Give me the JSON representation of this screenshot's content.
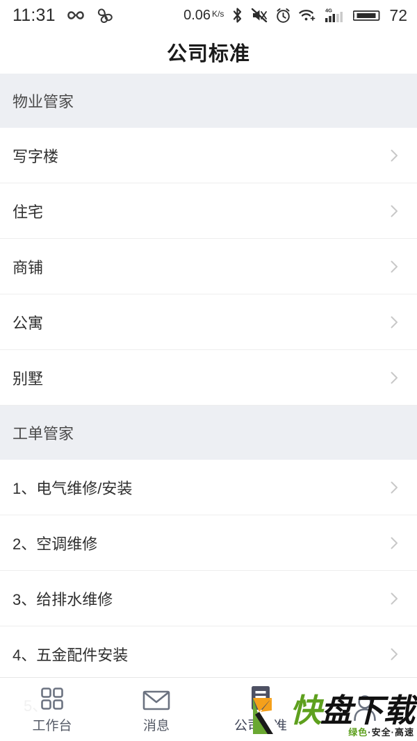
{
  "status_bar": {
    "time": "11:31",
    "left_icons": [
      "infinity-icon",
      "clover-icon"
    ],
    "network_speed": "0.06",
    "network_speed_unit_top": "K",
    "network_speed_unit_bottom": "s",
    "right_icons": [
      "bluetooth-icon",
      "mute-icon",
      "alarm-icon",
      "wifi-plus-icon",
      "signal-4g-icon"
    ],
    "signal_label": "4G",
    "battery_level": "72"
  },
  "header": {
    "title": "公司标准"
  },
  "sections": [
    {
      "title": "物业管家",
      "items": [
        {
          "label": "写字楼"
        },
        {
          "label": "住宅"
        },
        {
          "label": "商铺"
        },
        {
          "label": "公寓"
        },
        {
          "label": "别墅"
        }
      ]
    },
    {
      "title": "工单管家",
      "items": [
        {
          "label": "1、电气维修/安装"
        },
        {
          "label": "2、空调维修"
        },
        {
          "label": "3、给排水维修"
        },
        {
          "label": "4、五金配件安装"
        }
      ]
    }
  ],
  "ghost_text": "5、",
  "tabbar": {
    "tabs": [
      {
        "label": "工作台",
        "icon": "grid-icon",
        "active": false
      },
      {
        "label": "消息",
        "icon": "envelope-icon",
        "active": false
      },
      {
        "label": "公司标准",
        "icon": "book-icon",
        "active": true
      },
      {
        "label": "",
        "icon": "person-icon",
        "active": false
      }
    ],
    "active_color": "#4e5163",
    "inactive_color": "#6b7280"
  },
  "watermark": {
    "brand_green": "快",
    "brand_black": "盘下载",
    "tagline_1": "绿色",
    "tagline_dot_1": "·",
    "tagline_2": "安全",
    "tagline_dot_2": "·",
    "tagline_3": "高速",
    "green_hex": "#5ea01e",
    "orange_hex": "#f5a01b"
  }
}
